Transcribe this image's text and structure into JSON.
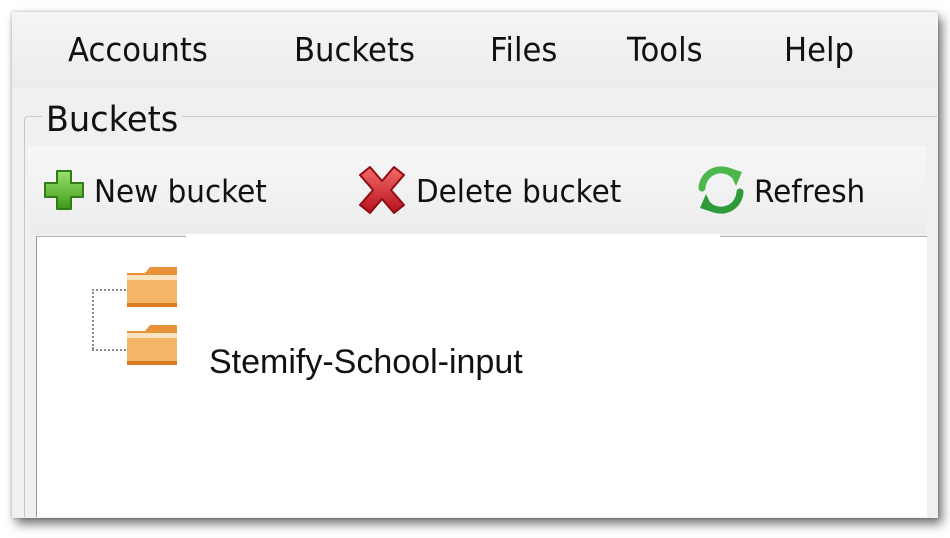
{
  "menu": {
    "items": [
      {
        "label": "Accounts"
      },
      {
        "label": "Buckets"
      },
      {
        "label": "Files"
      },
      {
        "label": "Tools"
      },
      {
        "label": "Help"
      }
    ]
  },
  "buckets_panel": {
    "group_label": "Buckets",
    "toolbar": {
      "new_bucket": {
        "label": "New bucket",
        "icon": "plus-icon",
        "color": "#5cb82a"
      },
      "delete_bucket": {
        "label": "Delete bucket",
        "icon": "red-x-icon",
        "color": "#d9272e"
      },
      "refresh": {
        "label": "Refresh",
        "icon": "refresh-icon",
        "color": "#3aa83a"
      }
    },
    "tree": {
      "nodes": [
        {
          "label": "",
          "icon": "folder-icon"
        },
        {
          "label": "Stemify-School-input",
          "icon": "folder-icon"
        }
      ]
    }
  },
  "colors": {
    "window_bg": "#f0f0f0",
    "folder": "#f2a54a"
  }
}
